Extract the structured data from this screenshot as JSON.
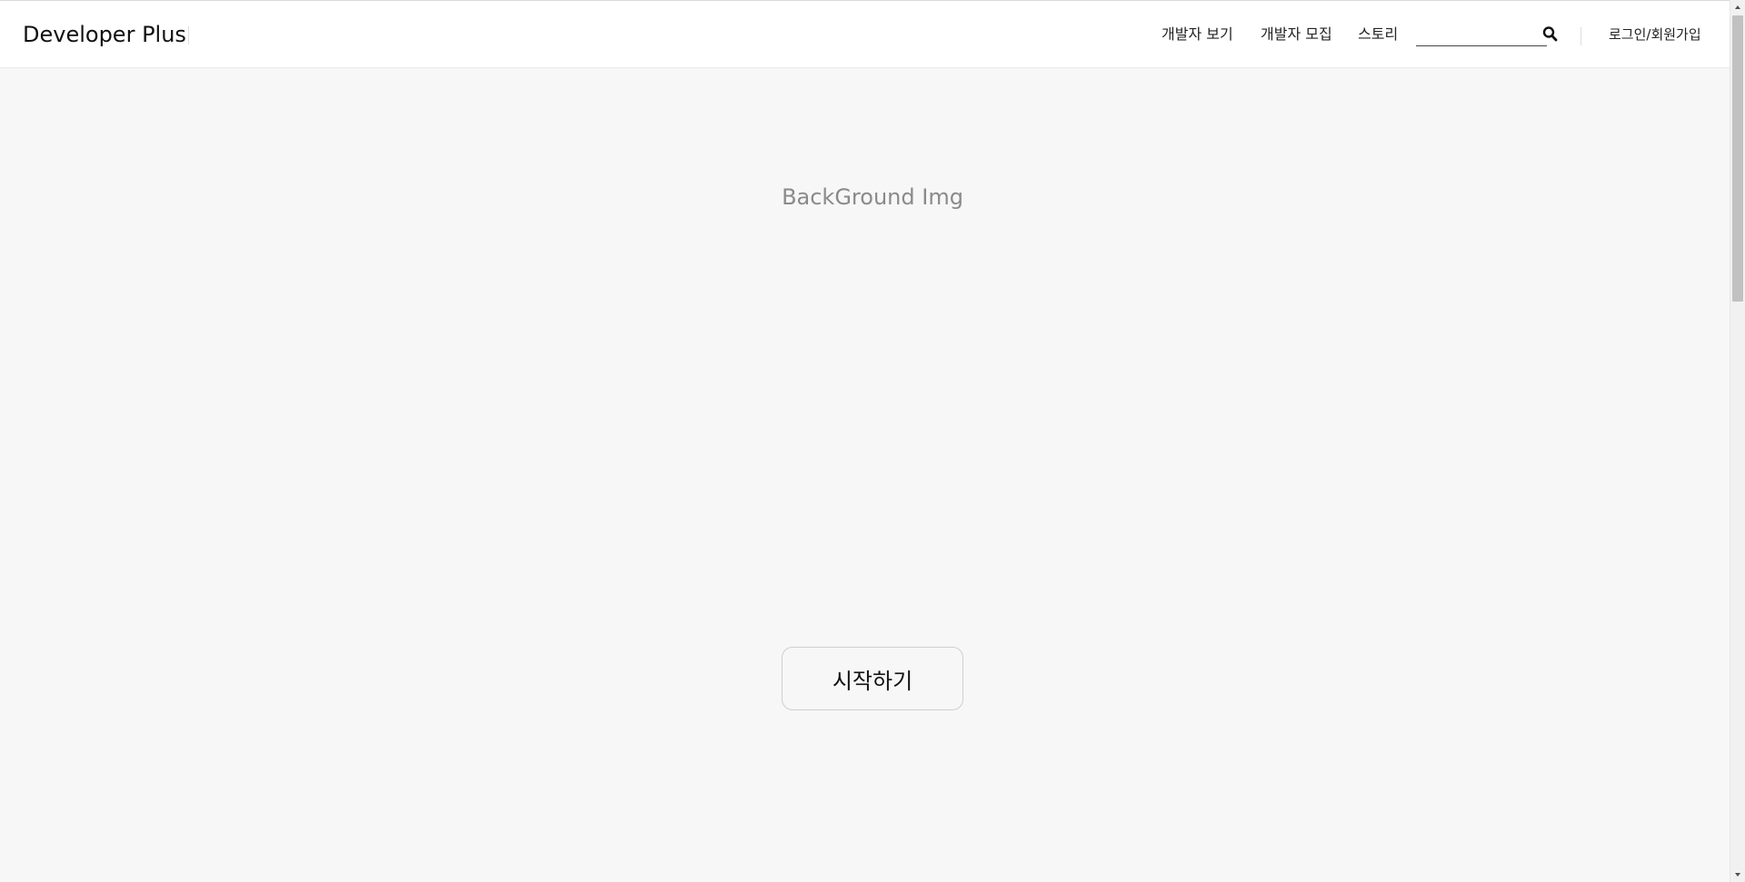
{
  "header": {
    "brand": "Developer Plus",
    "nav": [
      {
        "label": "개발자 보기"
      },
      {
        "label": "개발자 모집"
      },
      {
        "label": "스토리"
      }
    ],
    "search": {
      "value": "",
      "placeholder": ""
    },
    "login_label": "로그인/회원가입"
  },
  "hero": {
    "background_label": "BackGround Img",
    "start_button_label": "시작하기"
  },
  "icons": {
    "search": "search-icon",
    "scroll_up": "chevron-up-icon",
    "scroll_down": "chevron-down-icon"
  },
  "colors": {
    "page_background": "#f7f7f7",
    "header_background": "#ffffff",
    "placeholder_text": "#8a8a8a",
    "button_border": "#cfcfcf"
  }
}
